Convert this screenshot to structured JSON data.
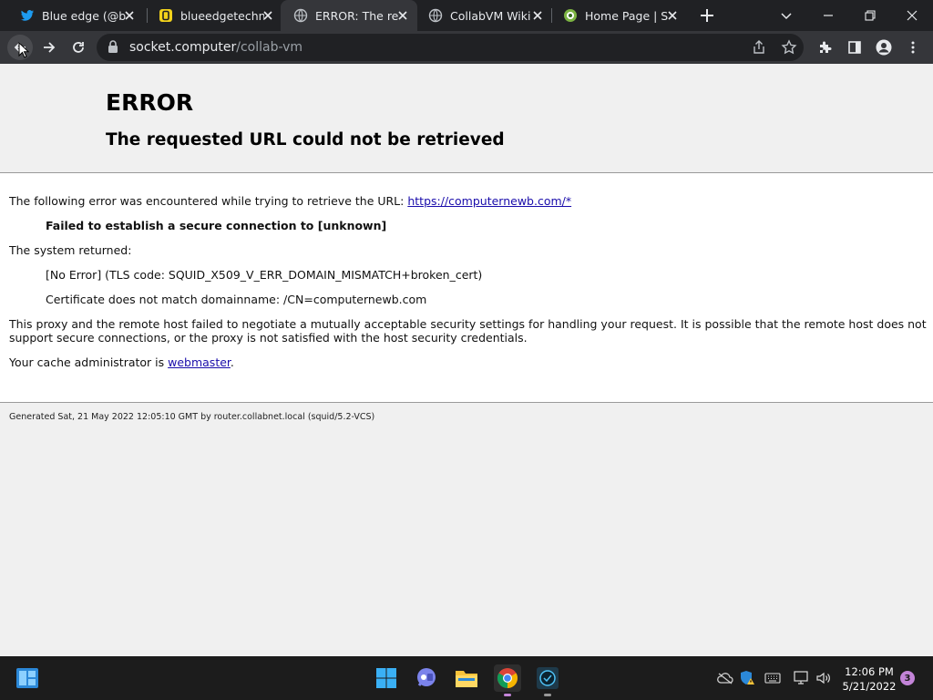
{
  "browser": {
    "tabs": [
      {
        "title": "Blue edge (@blu",
        "icon": "twitter-icon",
        "active": false
      },
      {
        "title": "blueedgetechno",
        "icon": "blueedge-favicon-icon",
        "active": false
      },
      {
        "title": "ERROR: The requ",
        "icon": "globe-icon",
        "active": true
      },
      {
        "title": "CollabVM Wiki",
        "icon": "globe-icon",
        "active": false
      },
      {
        "title": "Home Page | Se",
        "icon": "site-favicon-icon",
        "active": false
      }
    ],
    "url_host": "socket.computer",
    "url_path": "/collab-vm"
  },
  "page": {
    "title": "ERROR",
    "subtitle": "The requested URL could not be retrieved",
    "line1_text": "The following error was encountered while trying to retrieve the URL: ",
    "line1_link": "https://computernewb.com/*",
    "failed": "Failed to establish a secure connection to [unknown]",
    "system_returned": "The system returned:",
    "error_detail": "[No Error] (TLS code: SQUID_X509_V_ERR_DOMAIN_MISMATCH+broken_cert)",
    "cert_detail": "Certificate does not match domainname: /CN=computernewb.com",
    "proxy_line1": "This proxy and the remote host failed to negotiate a mutually acceptable security settings for handling your request. It is possible that the remote host does not",
    "proxy_line2": "support secure connections, or the proxy is not satisfied with the host security credentials.",
    "cache_admin": "Your cache administrator is ",
    "cache_admin_link": "webmaster",
    "cache_admin_end": ".",
    "footer": "Generated Sat, 21 May 2022 12:05:10 GMT by router.collabnet.local (squid/5.2-VCS)"
  },
  "taskbar": {
    "apps": [
      "start-icon",
      "teams-chat-icon",
      "file-explorer-icon",
      "chrome-icon",
      "terminal-app-icon"
    ],
    "time": "12:06 PM",
    "date": "5/21/2022",
    "notifications": "3"
  },
  "colors": {
    "tabstrip_bg": "#202124",
    "toolbar_bg": "#35363a",
    "link": "#1a0dab",
    "taskbar_bg": "#1c1c1c"
  }
}
